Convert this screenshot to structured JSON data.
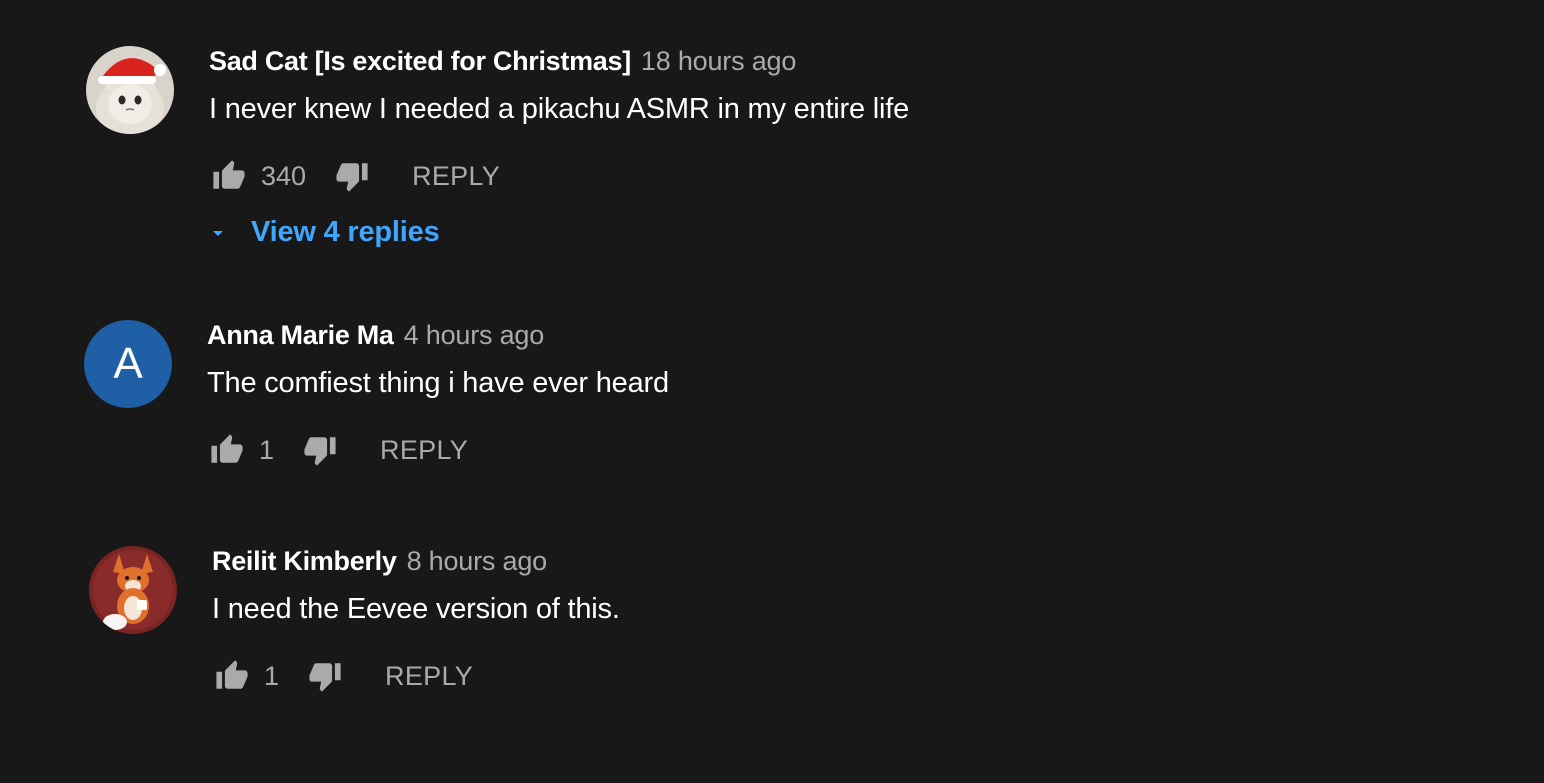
{
  "comments": [
    {
      "author": "Sad Cat [Is excited for Christmas]",
      "time": "18 hours ago",
      "text": "I never knew I needed a pikachu ASMR in my entire life",
      "likes": "340",
      "reply_label": "REPLY",
      "view_replies_label": "View 4 replies",
      "avatar_icon": "sad-cat-santa-hat-avatar"
    },
    {
      "author": "Anna Marie Ma",
      "time": "4 hours ago",
      "text": "The comfiest thing i have ever heard",
      "likes": "1",
      "reply_label": "REPLY",
      "avatar_letter": "A",
      "avatar_color": "#1f5fa6"
    },
    {
      "author": "Reilit Kimberly",
      "time": "8 hours ago",
      "text": "I need the Eevee version of this.",
      "likes": "1",
      "reply_label": "REPLY",
      "avatar_icon": "fox-avatar",
      "avatar_color": "#7a2424"
    }
  ],
  "colors": {
    "background": "#181818",
    "link": "#3ea6ff",
    "secondary_text": "#aaaaaa"
  }
}
